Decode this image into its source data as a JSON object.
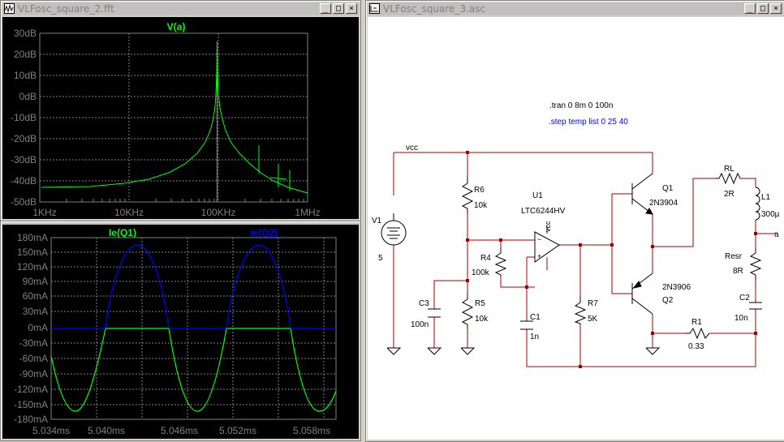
{
  "windows": {
    "fft": {
      "title": "VLFosc_square_2.fft"
    },
    "scope": {
      "title": ""
    },
    "schematic": {
      "title": "VLFosc_square_3.asc"
    }
  },
  "title_buttons": {
    "minimize": "_",
    "maximize": "□",
    "close": "×"
  },
  "fft_plot": {
    "trace": "V(a)",
    "y_ticks": [
      "30dB",
      "20dB",
      "10dB",
      "0dB",
      "-10dB",
      "-20dB",
      "-30dB",
      "-40dB",
      "-50dB"
    ],
    "x_ticks": [
      "1KHz",
      "10KHz",
      "100KHz",
      "1MHz"
    ],
    "colors": {
      "bg": "#000000",
      "grid": "#808080",
      "trace": "#00ff00"
    }
  },
  "time_plot": {
    "traces": [
      {
        "name": "Ie(Q1)",
        "color": "#00ff00"
      },
      {
        "name": "Ie(Q2)",
        "color": "#0000ff"
      }
    ],
    "y_ticks": [
      "180mA",
      "150mA",
      "120mA",
      "90mA",
      "60mA",
      "30mA",
      "0mA",
      "-30mA",
      "-60mA",
      "-90mA",
      "-120mA",
      "-150mA",
      "-180mA"
    ],
    "x_ticks": [
      "5.034ms",
      "5.040ms",
      "5.046ms",
      "5.052ms",
      "5.058ms"
    ]
  },
  "schematic": {
    "directives": {
      "tran": ".tran 0 8m 0 100n",
      "step": ".step temp list 0 25 40"
    },
    "nets": {
      "vcc": "vcc",
      "vcc_pin": "vcc",
      "a": "a"
    },
    "components": {
      "V1": {
        "ref": "V1",
        "value": "5"
      },
      "R6": {
        "ref": "R6",
        "value": "10k"
      },
      "R4": {
        "ref": "R4",
        "value": "100k"
      },
      "R5": {
        "ref": "R5",
        "value": "10k"
      },
      "C3": {
        "ref": "C3",
        "value": "100n"
      },
      "U1": {
        "ref": "U1",
        "value": "LTC6244HV"
      },
      "C1": {
        "ref": "C1",
        "value": "1n"
      },
      "R7": {
        "ref": "R7",
        "value": "5K"
      },
      "Q1": {
        "ref": "Q1",
        "value": "2N3904"
      },
      "Q2": {
        "ref": "Q2",
        "value": "2N3906"
      },
      "R1": {
        "ref": "R1",
        "value": "0.33"
      },
      "RL": {
        "ref": "RL",
        "value": "2R"
      },
      "L1": {
        "ref": "L1",
        "value": "300µ"
      },
      "Resr": {
        "ref": "Resr",
        "value": "8R"
      },
      "C2": {
        "ref": "C2",
        "value": "10n"
      }
    },
    "colors": {
      "wire": "#a00000",
      "part": "#000000",
      "junction": "#a00000",
      "directive": "#000000",
      "step_directive": "#0000ff"
    }
  }
}
